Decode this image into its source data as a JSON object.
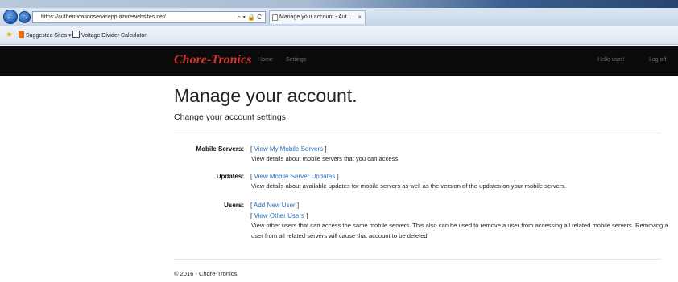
{
  "browser": {
    "address": "https://authenticationservicepp.azurewebsites.net/",
    "address_controls": "⌕ ▾ 🔒 C",
    "tab_title": "Manage your account - Aut...",
    "tab_close": "×",
    "back_glyph": "←",
    "forward_glyph": "→",
    "favorites": [
      {
        "label": "Suggested Sites ▾"
      },
      {
        "label": "Voltage Divider Calculator"
      }
    ]
  },
  "site": {
    "brand": "Chore-Tronics",
    "brand_color": "#d0342c",
    "nav": [
      "Home",
      "Settings",
      "Hello user!",
      "Log off"
    ]
  },
  "page": {
    "title": "Manage your account.",
    "subtitle": "Change your account settings"
  },
  "sections": [
    {
      "label": "Mobile Servers:",
      "links": [
        "View My Mobile Servers"
      ],
      "description": "View details about mobile servers that you can access."
    },
    {
      "label": "Updates:",
      "links": [
        "View Mobile Server Updates"
      ],
      "description": "View details about available updates for mobile servers as well as the version of the updates on your mobile servers."
    },
    {
      "label": "Users:",
      "links": [
        "Add New User",
        "View Other Users"
      ],
      "description": "View other users that can access the same mobile servers. This also can be used to remove a user from accessing all related mobile servers. Removing a user from all related servers will cause that account to be deleted"
    }
  ],
  "footer": "© 2016 - Chore-Tronics",
  "icons": [
    "back-arrow-icon",
    "forward-arrow-icon",
    "favorites-star-icon",
    "close-icon"
  ]
}
